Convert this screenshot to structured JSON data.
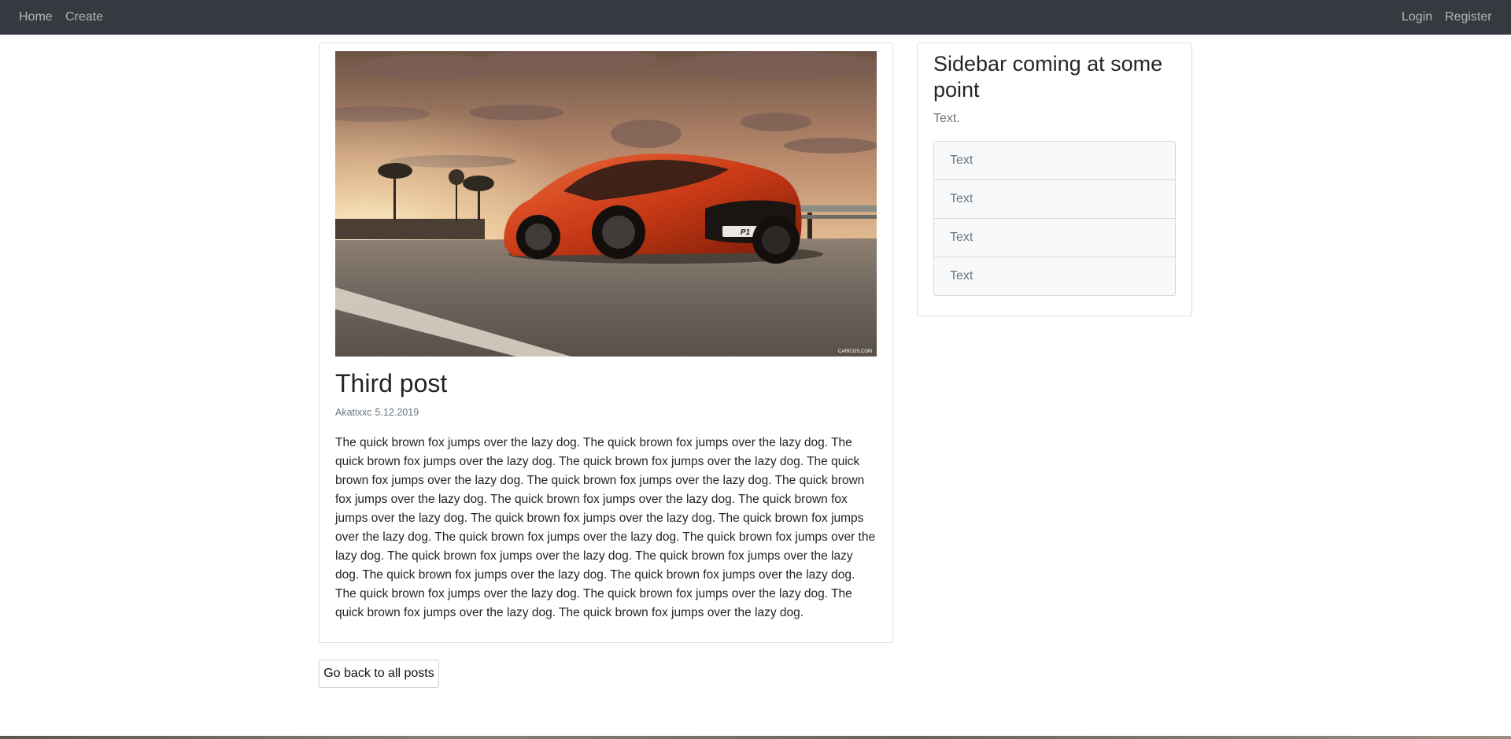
{
  "nav": {
    "left": [
      "Home",
      "Create"
    ],
    "right": [
      "Login",
      "Register"
    ]
  },
  "post": {
    "image_alt": "Orange sports car on a road at sunset",
    "image_watermark": "CARICOS.COM",
    "title": "Third post",
    "author": "Akatixxc",
    "date": "5.12.2019",
    "body": "The quick brown fox jumps over the lazy dog. The quick brown fox jumps over the lazy dog. The quick brown fox jumps over the lazy dog. The quick brown fox jumps over the lazy dog. The quick brown fox jumps over the lazy dog. The quick brown fox jumps over the lazy dog. The quick brown fox jumps over the lazy dog. The quick brown fox jumps over the lazy dog. The quick brown fox jumps over the lazy dog. The quick brown fox jumps over the lazy dog. The quick brown fox jumps over the lazy dog. The quick brown fox jumps over the lazy dog. The quick brown fox jumps over the lazy dog. The quick brown fox jumps over the lazy dog. The quick brown fox jumps over the lazy dog. The quick brown fox jumps over the lazy dog. The quick brown fox jumps over the lazy dog. The quick brown fox jumps over the lazy dog. The quick brown fox jumps over the lazy dog. The quick brown fox jumps over the lazy dog. The quick brown fox jumps over the lazy dog."
  },
  "back_button": "Go back to all posts",
  "sidebar": {
    "title": "Sidebar coming at some point",
    "text": "Text.",
    "items": [
      "Text",
      "Text",
      "Text",
      "Text"
    ]
  },
  "colors": {
    "navbar": "#343a40",
    "nav_link": "#9da1a5",
    "muted": "#6c757d",
    "body_text": "#212529",
    "car": "#d8431c"
  }
}
